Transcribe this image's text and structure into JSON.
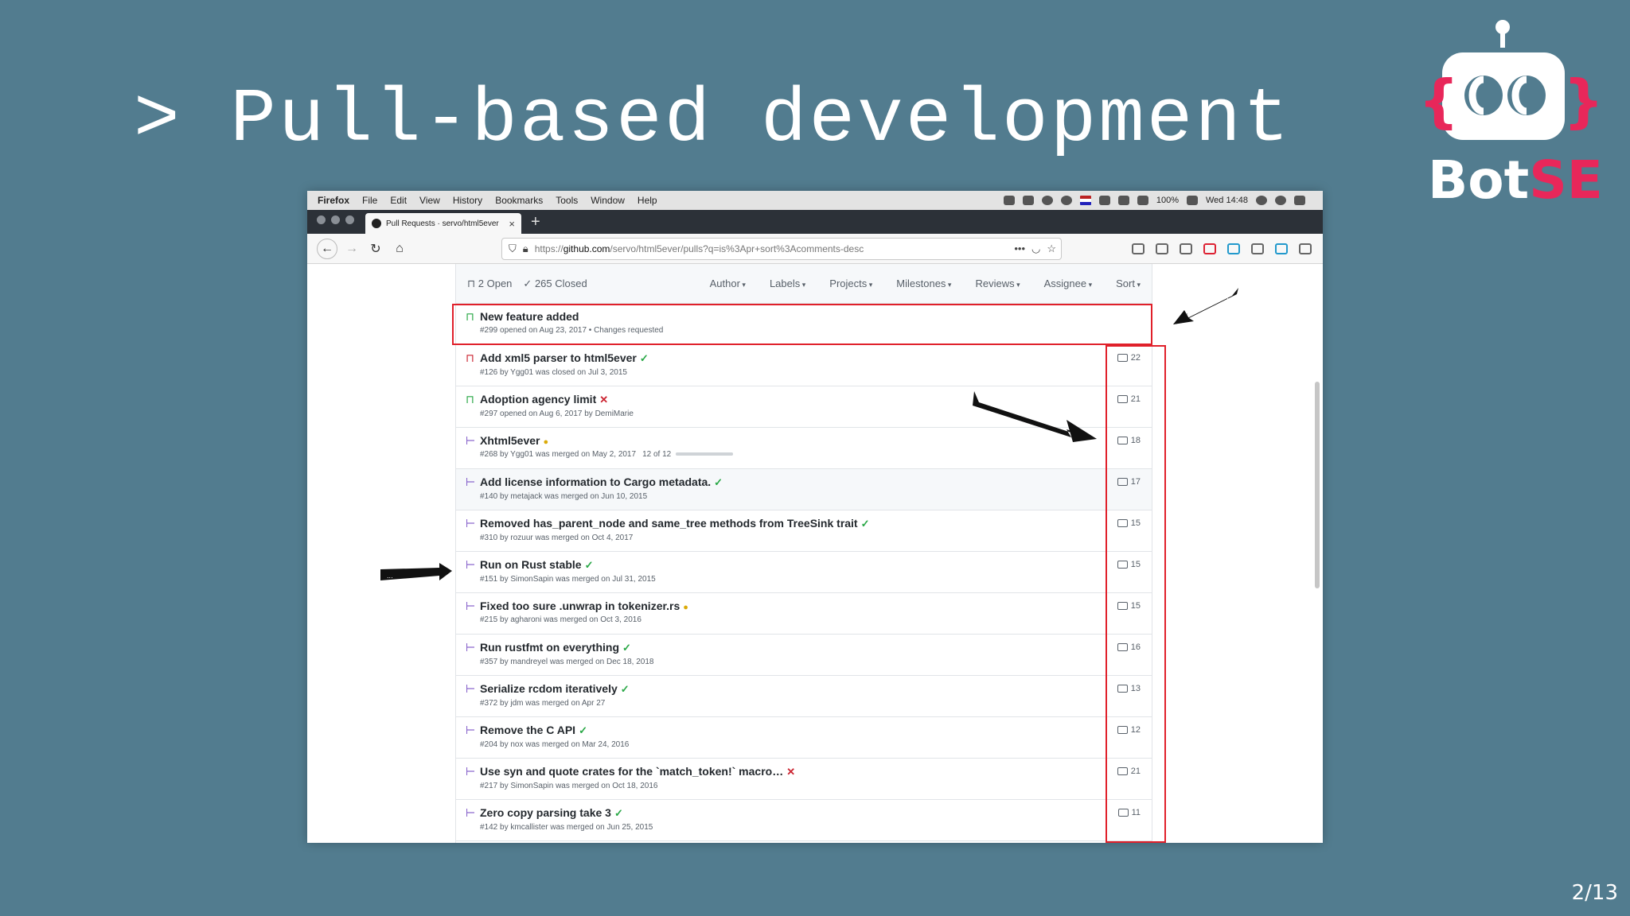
{
  "slide": {
    "title": "> Pull-based development",
    "page": "2/13",
    "logo": {
      "text_bot": "Bot",
      "text_se": "SE",
      "accent": "#e8275a"
    }
  },
  "menubar": {
    "items": [
      "Firefox",
      "File",
      "Edit",
      "View",
      "History",
      "Bookmarks",
      "Tools",
      "Window",
      "Help"
    ],
    "battery": "100%",
    "clock": "Wed 14:48"
  },
  "tab": {
    "label": "Pull Requests · servo/html5ever",
    "new_tab": "+"
  },
  "urlbar": {
    "prefix": "https://",
    "host": "github.com",
    "path": "/servo/html5ever/pulls?q=is%3Apr+sort%3Acomments-desc",
    "more": "•••"
  },
  "list_header": {
    "open": "2 Open",
    "closed": "265 Closed",
    "filters": [
      "Author",
      "Labels",
      "Projects",
      "Milestones",
      "Reviews",
      "Assignee",
      "Sort"
    ]
  },
  "rows": [
    {
      "state": "open",
      "icon": "⊓",
      "title": "New feature added",
      "mark": "",
      "meta": "#299 opened on Aug 23, 2017 • Changes requested",
      "comments": ""
    },
    {
      "state": "closed",
      "icon": "⊓",
      "title": "Add xml5 parser to html5ever",
      "mark": "ok",
      "meta": "#126 by Ygg01 was closed on Jul 3, 2015",
      "comments": "22"
    },
    {
      "state": "open",
      "icon": "⊓",
      "title": "Adoption agency limit",
      "mark": "bad",
      "meta": "#297 opened on Aug 6, 2017 by DemiMarie",
      "comments": "21"
    },
    {
      "state": "merged",
      "icon": "⊢",
      "title": "Xhtml5ever",
      "mark": "pend",
      "meta": "#268 by Ygg01 was merged on May 2, 2017",
      "tasks": "12 of 12",
      "task_progress": 1.0,
      "comments": "18"
    },
    {
      "state": "merged",
      "icon": "⊢",
      "title": "Add license information to Cargo metadata.",
      "mark": "ok",
      "meta": "#140 by metajack was merged on Jun 10, 2015",
      "comments": "17",
      "highlight": true
    },
    {
      "state": "merged",
      "icon": "⊢",
      "title": "Removed has_parent_node and same_tree methods from TreeSink trait",
      "mark": "ok",
      "meta": "#310 by rozuur was merged on Oct 4, 2017",
      "comments": "15"
    },
    {
      "state": "merged",
      "icon": "⊢",
      "title": "Run on Rust stable",
      "mark": "ok",
      "meta": "#151 by SimonSapin was merged on Jul 31, 2015",
      "comments": "15"
    },
    {
      "state": "merged",
      "icon": "⊢",
      "title": "Fixed too sure .unwrap in tokenizer.rs",
      "mark": "pend",
      "meta": "#215 by agharoni was merged on Oct 3, 2016",
      "comments": "15"
    },
    {
      "state": "merged",
      "icon": "⊢",
      "title": "Run rustfmt on everything",
      "mark": "ok",
      "meta": "#357 by mandreyel was merged on Dec 18, 2018",
      "comments": "16"
    },
    {
      "state": "merged",
      "icon": "⊢",
      "title": "Serialize rcdom iteratively",
      "mark": "ok",
      "meta": "#372 by jdm was merged on Apr 27",
      "comments": "13"
    },
    {
      "state": "merged",
      "icon": "⊢",
      "title": "Remove the C API",
      "mark": "ok",
      "meta": "#204 by nox was merged on Mar 24, 2016",
      "comments": "12"
    },
    {
      "state": "merged",
      "icon": "⊢",
      "title": "Use syn and quote crates for the `match_token!` macro…",
      "mark": "bad",
      "meta": "#217 by SimonSapin was merged on Oct 18, 2016",
      "comments": "21"
    },
    {
      "state": "merged",
      "icon": "⊢",
      "title": "Zero copy parsing take 3",
      "mark": "ok",
      "meta": "#142 by kmcallister was merged on Jun 25, 2015",
      "comments": "11"
    }
  ],
  "marks": {
    "ok": "✓",
    "bad": "✕",
    "pend": "●"
  },
  "annotation_arrow_text": "...",
  "colors": {
    "background": "#527c8f",
    "highlight_box": "#e0202a",
    "open": "#28a745",
    "closed": "#cb2431",
    "merged": "#6f42c1"
  }
}
